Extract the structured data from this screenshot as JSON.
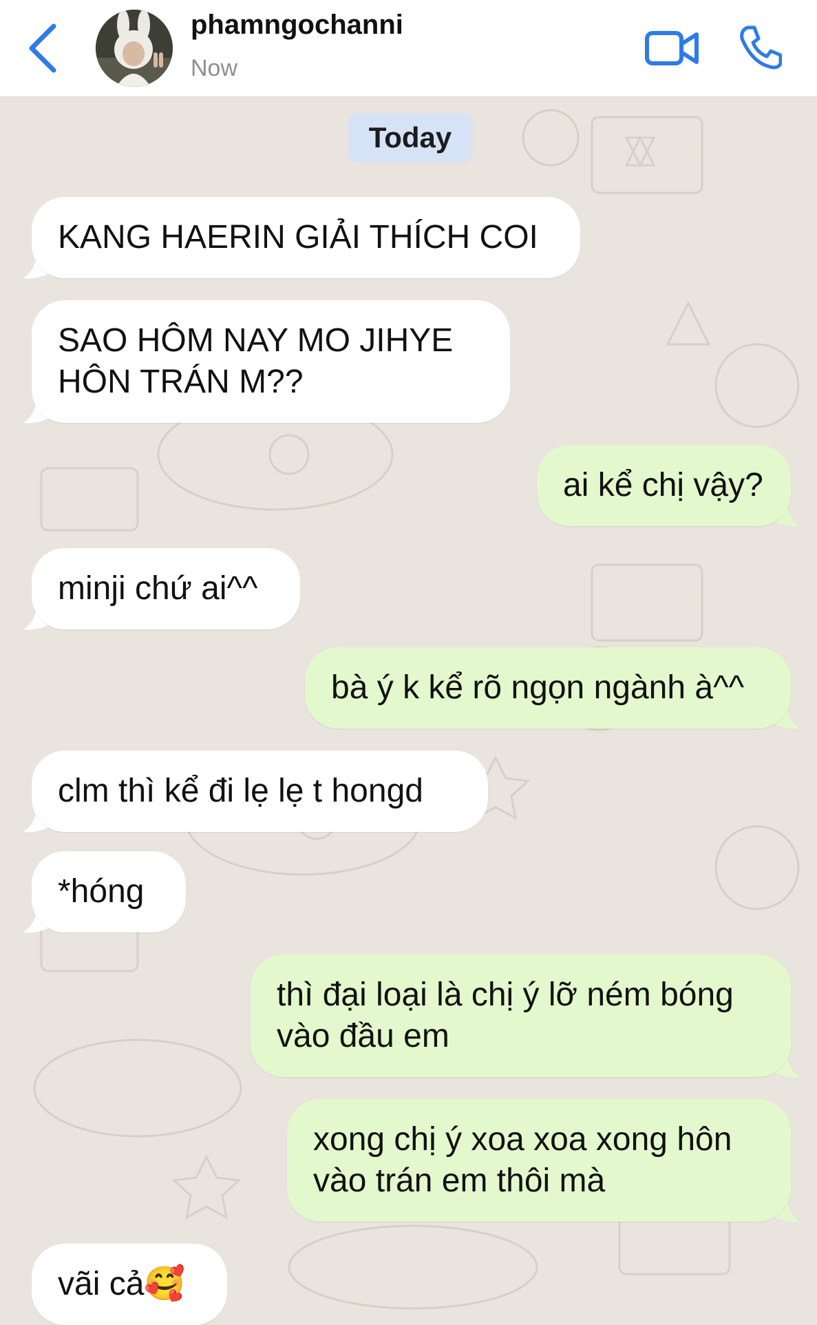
{
  "header": {
    "contact_name": "phamngochanni",
    "status": "Now",
    "back_icon": "chevron-left-icon",
    "video_icon": "video-camera-icon",
    "call_icon": "phone-icon"
  },
  "date_separator": "Today",
  "colors": {
    "accent": "#2f7be6",
    "incoming_bubble": "#ffffff",
    "outgoing_bubble": "#e3f8cd",
    "date_pill": "#d6e2f5",
    "wallpaper": "#e9e4dd"
  },
  "messages": [
    {
      "direction": "incoming",
      "text": "KANG HAERIN GIẢI THÍCH COI"
    },
    {
      "direction": "incoming",
      "text": "SAO HÔM NAY MO JIHYE\nHÔN TRÁN M??"
    },
    {
      "direction": "outgoing",
      "text": "ai kể chị vậy?"
    },
    {
      "direction": "incoming",
      "text": "minji chứ ai^^"
    },
    {
      "direction": "outgoing",
      "text": "bà ý k kể rõ ngọn ngành à^^"
    },
    {
      "direction": "incoming",
      "text": "clm thì kể đi lẹ lẹ t hongd"
    },
    {
      "direction": "incoming",
      "text": "*hóng"
    },
    {
      "direction": "outgoing",
      "text": "thì đại loại là chị ý lỡ ném bóng\nvào đầu em"
    },
    {
      "direction": "outgoing",
      "text": "xong chị ý xoa xoa xong hôn\nvào trán em thôi mà"
    },
    {
      "direction": "incoming",
      "text": "vãi cả🥰"
    }
  ]
}
